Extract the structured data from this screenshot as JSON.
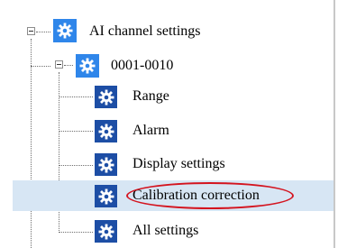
{
  "tree": {
    "root": {
      "label": "AI channel settings",
      "icon": "gear-icon",
      "expanded": true
    },
    "group": {
      "label": "0001-0010",
      "icon": "gear-icon",
      "expanded": true
    },
    "items": [
      {
        "label": "Range",
        "icon": "gear-icon"
      },
      {
        "label": "Alarm",
        "icon": "gear-icon"
      },
      {
        "label": "Display settings",
        "icon": "gear-icon"
      },
      {
        "label": "Calibration correction",
        "icon": "gear-icon",
        "selected": true,
        "annotated": true
      },
      {
        "label": "All settings",
        "icon": "gear-icon"
      }
    ]
  },
  "colors": {
    "root_icon_bg": "#2f86ea",
    "child_icon_bg": "#1d4ea5",
    "selection_bg": "#d7e6f4",
    "annotation": "#d4141f"
  }
}
